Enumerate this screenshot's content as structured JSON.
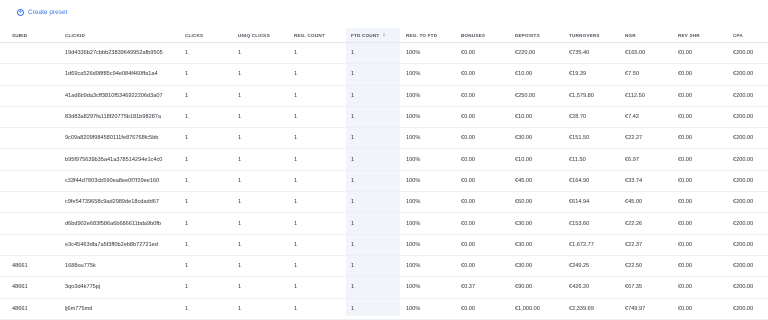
{
  "toolbar": {
    "create_preset_label": "Create preset"
  },
  "table": {
    "headers": {
      "subid": "SUBID",
      "clickid": "CLICKID",
      "clicks": "CLICKS",
      "uniq_clicks": "UNIQ CLICKS",
      "reg_count": "REG. COUNT",
      "ftd_count": "FTD COUNT",
      "reg_to_ftd": "REG. TO FTD",
      "bonuses": "BONUSES",
      "deposits": "DEPOSITS",
      "turnovers": "TURNOVERS",
      "ngr": "NGR",
      "rev_shr": "REV SHR",
      "cpa": "CPA"
    },
    "sort_icon": "arrow-down-icon",
    "rows": [
      {
        "subid": "",
        "clickid": "19d4336b27cbbb23839649952afb9505",
        "clicks": "1",
        "uniq": "1",
        "reg": "1",
        "ftd": "1",
        "regftd": "100%",
        "bonus": "€0.00",
        "dep": "€220.00",
        "turn": "€735.40",
        "ngr": "€165.00",
        "rev": "€0.00",
        "cpa": "€200.00"
      },
      {
        "subid": "",
        "clickid": "1d69ca526d98f85c94e084f460ffa1a4",
        "clicks": "1",
        "uniq": "1",
        "reg": "1",
        "ftd": "1",
        "regftd": "100%",
        "bonus": "€0.00",
        "dep": "€10.00",
        "turn": "€19.39",
        "ngr": "€7.50",
        "rev": "€0.00",
        "cpa": "€200.00"
      },
      {
        "subid": "",
        "clickid": "41ad6b9da3cff3810f5346922206d3a07",
        "clicks": "1",
        "uniq": "1",
        "reg": "1",
        "ftd": "1",
        "regftd": "100%",
        "bonus": "€0.00",
        "dep": "€250.00",
        "turn": "€1,579.80",
        "ngr": "€112.50",
        "rev": "€0.00",
        "cpa": "€200.00"
      },
      {
        "subid": "",
        "clickid": "83d83a8297fa118f20775b181b98287a",
        "clicks": "1",
        "uniq": "1",
        "reg": "1",
        "ftd": "1",
        "regftd": "100%",
        "bonus": "€0.00",
        "dep": "€10.00",
        "turn": "€28.70",
        "ngr": "€7.42",
        "rev": "€0.00",
        "cpa": "€200.00"
      },
      {
        "subid": "",
        "clickid": "9c09a8209f984580111fe876768fc5bb",
        "clicks": "1",
        "uniq": "1",
        "reg": "1",
        "ftd": "1",
        "regftd": "100%",
        "bonus": "€0.00",
        "dep": "€30.00",
        "turn": "€151.50",
        "ngr": "€22.27",
        "rev": "€0.00",
        "cpa": "€200.00"
      },
      {
        "subid": "",
        "clickid": "b95f975639b35a41a378514294e1c4c0",
        "clicks": "1",
        "uniq": "1",
        "reg": "1",
        "ftd": "1",
        "regftd": "100%",
        "bonus": "€0.00",
        "dep": "€10.00",
        "turn": "€11.50",
        "ngr": "€6.97",
        "rev": "€0.00",
        "cpa": "€200.00"
      },
      {
        "subid": "",
        "clickid": "c33f44d7803cb590ea8ee0f7f29ee160",
        "clicks": "1",
        "uniq": "1",
        "reg": "1",
        "ftd": "1",
        "regftd": "100%",
        "bonus": "€0.00",
        "dep": "€45.00",
        "turn": "€164.90",
        "ngr": "€33.74",
        "rev": "€0.00",
        "cpa": "€200.00"
      },
      {
        "subid": "",
        "clickid": "c9fe54739658c9ad2989de18cdadd67",
        "clicks": "1",
        "uniq": "1",
        "reg": "1",
        "ftd": "1",
        "regftd": "100%",
        "bonus": "€0.00",
        "dep": "€60.00",
        "turn": "€614.94",
        "ngr": "€45.00",
        "rev": "€0.00",
        "cpa": "€200.00"
      },
      {
        "subid": "",
        "clickid": "d6bd902e683f586a6b686611bda9b0fb",
        "clicks": "1",
        "uniq": "1",
        "reg": "1",
        "ftd": "1",
        "regftd": "100%",
        "bonus": "€0.00",
        "dep": "€30.00",
        "turn": "€153.60",
        "ngr": "€22.26",
        "rev": "€0.00",
        "cpa": "€200.00"
      },
      {
        "subid": "",
        "clickid": "e3c45463dfa7a5f3ff0b2eb8b72721ed",
        "clicks": "1",
        "uniq": "1",
        "reg": "1",
        "ftd": "1",
        "regftd": "100%",
        "bonus": "€0.00",
        "dep": "€30.00",
        "turn": "€1,672.77",
        "ngr": "€22.37",
        "rev": "€0.00",
        "cpa": "€200.00"
      },
      {
        "subid": "48661",
        "clickid": "1688ou775k",
        "clicks": "1",
        "uniq": "1",
        "reg": "1",
        "ftd": "1",
        "regftd": "100%",
        "bonus": "€0.00",
        "dep": "€30.00",
        "turn": "€249.25",
        "ngr": "€22.50",
        "rev": "€0.00",
        "cpa": "€200.00"
      },
      {
        "subid": "48661",
        "clickid": "3qo3d4k775pj",
        "clicks": "1",
        "uniq": "1",
        "reg": "1",
        "ftd": "1",
        "regftd": "100%",
        "bonus": "€0.37",
        "dep": "€90.00",
        "turn": "€426.20",
        "ngr": "€67.35",
        "rev": "€0.00",
        "cpa": "€200.00"
      },
      {
        "subid": "48661",
        "clickid": "lj6m775md",
        "clicks": "1",
        "uniq": "1",
        "reg": "1",
        "ftd": "1",
        "regftd": "100%",
        "bonus": "€0.00",
        "dep": "€1,000.00",
        "turn": "€2,339.69",
        "ngr": "€749.97",
        "rev": "€0.00",
        "cpa": "€200.00"
      }
    ]
  }
}
